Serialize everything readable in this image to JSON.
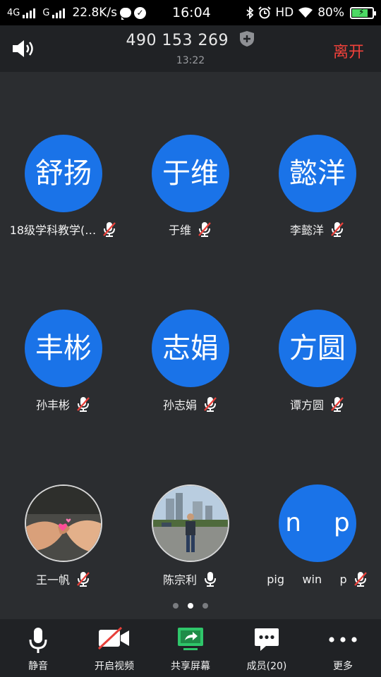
{
  "status_bar": {
    "network1": "4G",
    "network2": "G",
    "speed": "22.8K/s",
    "time": "16:04",
    "hd": "HD",
    "battery_percent": "80%",
    "battery_level": 0.8
  },
  "header": {
    "meeting_id": "490 153 269",
    "elapsed": "13:22",
    "leave_label": "离开"
  },
  "participants": [
    {
      "avatar_text": "舒扬",
      "name": "18级学科教学(…",
      "mic": "muted",
      "photo": null
    },
    {
      "avatar_text": "于维",
      "name": "于维",
      "mic": "muted",
      "photo": null
    },
    {
      "avatar_text": "懿洋",
      "name": "李懿洋",
      "mic": "muted",
      "photo": null
    },
    {
      "avatar_text": "丰彬",
      "name": "孙丰彬",
      "mic": "muted",
      "photo": null
    },
    {
      "avatar_text": "志娟",
      "name": "孙志娟",
      "mic": "muted",
      "photo": null
    },
    {
      "avatar_text": "方圆",
      "name": "谭方圆",
      "mic": "muted",
      "photo": null
    },
    {
      "avatar_text": "",
      "name": "王一帆",
      "mic": "muted",
      "photo": "hands-heart"
    },
    {
      "avatar_text": "",
      "name": "陈宗利",
      "mic": "on",
      "photo": "man-outdoors"
    },
    {
      "avatar_text": "n    p",
      "name": "pig     win     p",
      "mic": "muted",
      "photo": null
    }
  ],
  "pagination": {
    "total": 3,
    "current": 2
  },
  "toolbar": {
    "mute_label": "静音",
    "video_label": "开启视频",
    "share_label": "共享屏幕",
    "members_label": "成员(20)",
    "more_label": "更多"
  },
  "colors": {
    "avatar_blue": "#1a73e8",
    "leave_red": "#f0413a",
    "background": "#2b2d30",
    "bar": "#202225",
    "share_green": "#2fc66a"
  }
}
